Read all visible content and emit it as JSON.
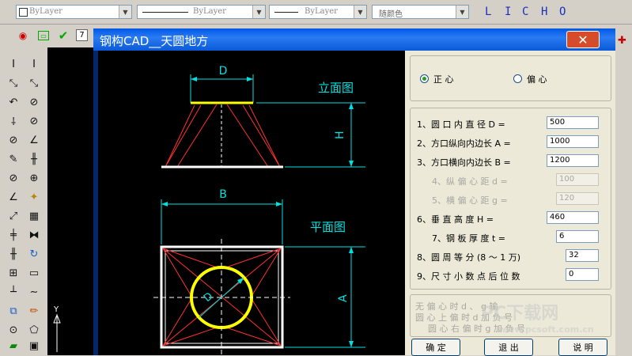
{
  "toolbar": {
    "layer_combo": "ByLayer",
    "linetype_combo": "ByLayer",
    "lineweight_combo": "ByLayer",
    "color_combo": "随颜色",
    "tool_letters": [
      "L",
      "I",
      "C",
      "H",
      "O"
    ]
  },
  "dialog": {
    "title": "钢构CAD__天圆地方",
    "close_glyph": "✕"
  },
  "drawing": {
    "elevation_label": "立面图",
    "plan_label": "平面图",
    "dim_D": "D",
    "dim_H": "H",
    "dim_B": "B",
    "dim_A": "A",
    "dim_D_inner": "D"
  },
  "panel": {
    "radio_centered": "正  心",
    "radio_offset": "偏  心",
    "fields": [
      {
        "label": "1、圆 口 内 直 径 D =",
        "value": "500",
        "enabled": true
      },
      {
        "label": "2、方口纵向内边长 A =",
        "value": "1000",
        "enabled": true
      },
      {
        "label": "3、方口横向内边长 B =",
        "value": "1200",
        "enabled": true
      },
      {
        "label": "4、纵 偏 心 距 d =",
        "value": "100",
        "enabled": false
      },
      {
        "label": "5、横 偏 心 距 g =",
        "value": "120",
        "enabled": false
      },
      {
        "label": "6、垂 直 高 度 H =",
        "value": "460",
        "enabled": true
      },
      {
        "label": "7、钢 板 厚 度 t =",
        "value": "6",
        "enabled": true
      },
      {
        "label": "8、圆 周 等 分 (8 ～ 1 万)",
        "value": "32",
        "enabled": true
      },
      {
        "label": "9、尺 寸 小 数 点 后 位 数",
        "value": "0",
        "enabled": true
      }
    ],
    "notes": [
      "无 偏 心 时  d 、 g 输",
      "圆 心 上 偏 时  d  加 负 号",
      "圆 心 右 偏 时  g  加 负 号"
    ],
    "btn_ok": "确  定",
    "btn_exit": "退  出",
    "btn_help": "说  明"
  },
  "watermark": {
    "brand": "PC下载网",
    "url": "www.pcsoft.com.cn"
  },
  "colors": {
    "cad_yellow": "#ffff00",
    "cad_red": "#ff3030",
    "cad_cyan": "#00e0e0",
    "cad_white": "#ffffff",
    "title_blue": "#0058e6"
  }
}
